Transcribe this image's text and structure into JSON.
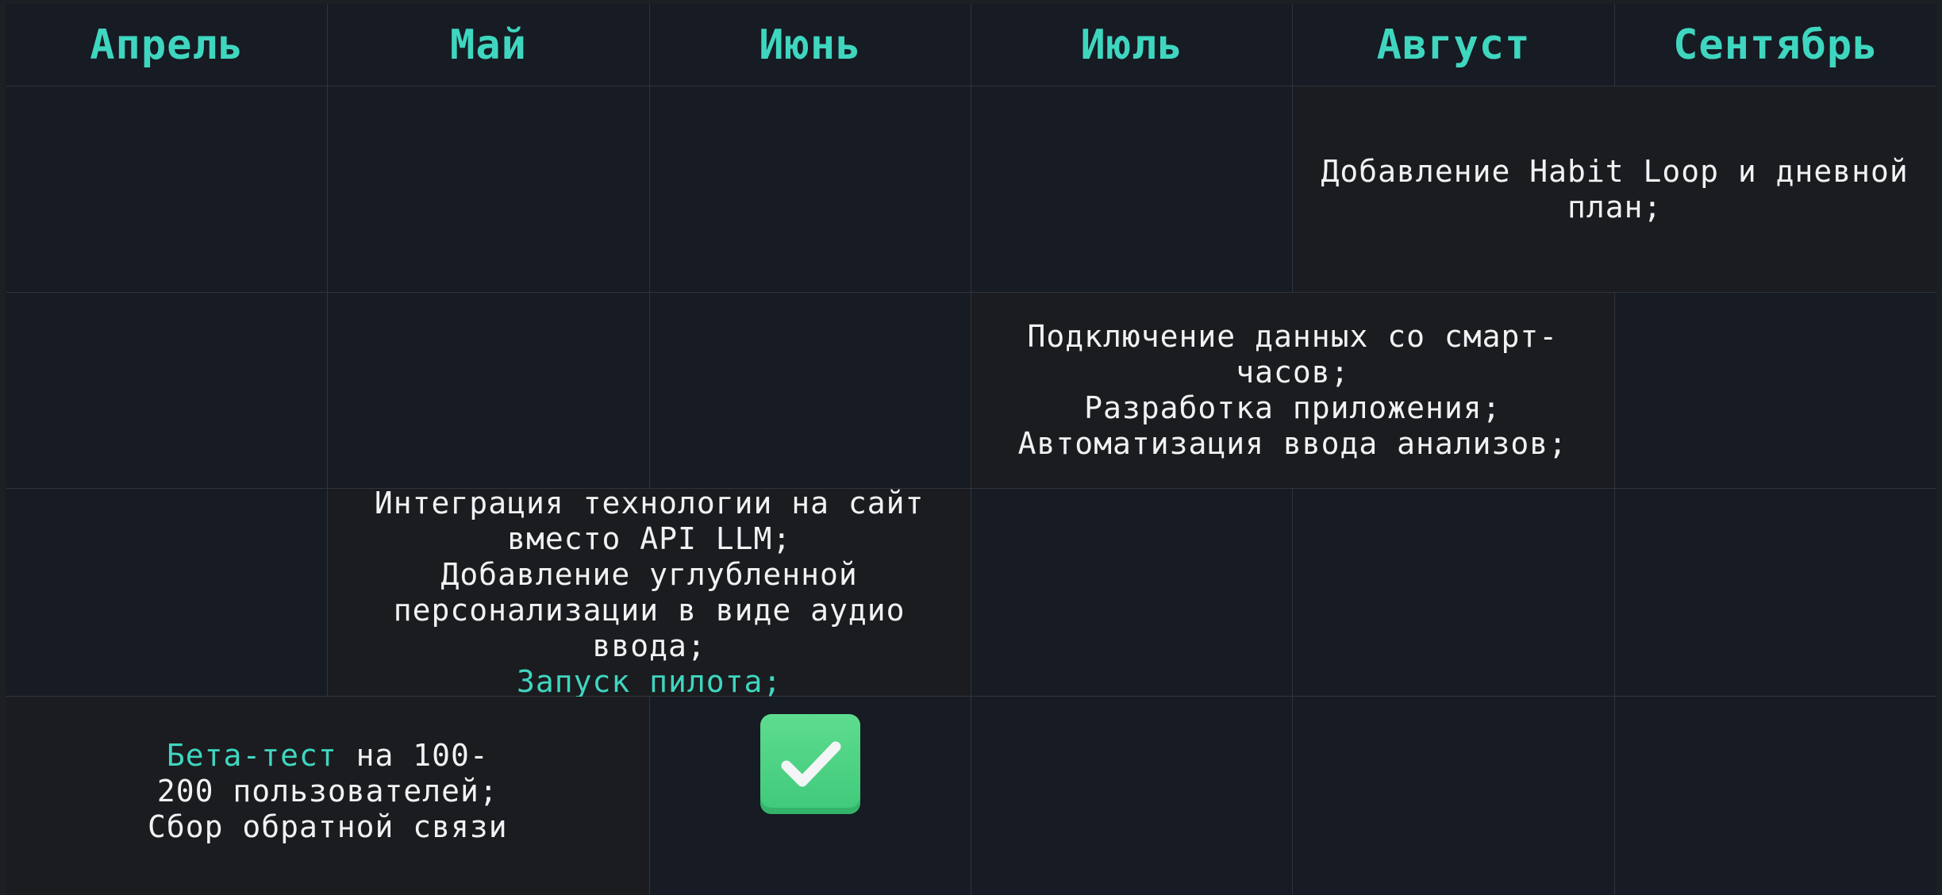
{
  "months": [
    "Апрель",
    "Май",
    "Июнь",
    "Июль",
    "Август",
    "Сентябрь"
  ],
  "tasks": {
    "habit_loop": "Добавление Habit Loop и дневной план;",
    "smartwatch": "Подключение данных со смарт-часов;",
    "app_dev": "Разработка приложения;",
    "automation": "Автоматизация ввода анализов;",
    "integration": "Интеграция технологии на сайт вместо API LLM;",
    "personalization": "Добавление углубленной персонализации в виде аудио ввода;",
    "pilot": "Запуск пилота;",
    "beta_prefix": "Бета-тест",
    "beta_rest": " на 100-200 пользователей;",
    "feedback": "Сбор обратной связи"
  },
  "icons": {
    "done": "check-icon"
  },
  "colors": {
    "accent": "#3fd6c0",
    "check": "#4fd585"
  }
}
